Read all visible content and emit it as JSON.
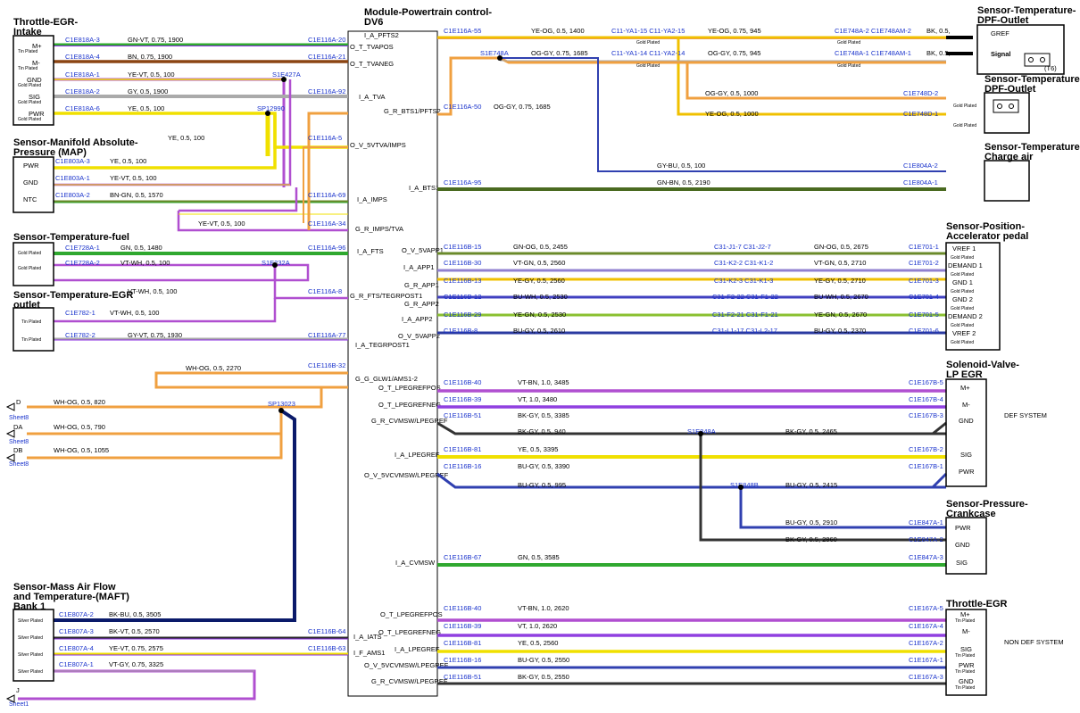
{
  "module": {
    "title_line1": "Module-Powertrain control-",
    "title_line2": "DV6",
    "signals": [
      "I_A_PFTS2",
      "O_T_TVAPOS",
      "O_T_TVANEG",
      "I_A_TVA",
      "G_R_BTS1/PFTS2",
      "O_V_5VTVA/IMPS",
      "I_A_BTS1",
      "I_A_IMPS",
      "G_R_IMPS/TVA",
      "I_A_FTS",
      "O_V_5VAPP1",
      "I_A_APP1",
      "G_R_APP1",
      "G_R_FTS/TEGRPOST1",
      "G_R_APP2",
      "I_A_APP2",
      "O_V_5VAPP2",
      "I_A_TEGRPOST1",
      "G_G_GLW1/AMS1-2",
      "O_T_LPEGREFPOS",
      "O_T_LPEGREFNEG",
      "G_R_CVMSW/LPEGREF",
      "I_A_LPEGREF",
      "O_V_5VCVMSW/LPEGREF",
      "I_A_CVMSW",
      "O_T_LPEGREFPOS",
      "O_T_LPEGREFNEG",
      "I_A_LPEGREF",
      "O_V_5VCVMSW/LPEGREF",
      "G_R_CVMSW/LPEGREF",
      "I_A_IATS",
      "I_F_AMS1"
    ]
  },
  "components": {
    "throttle_intake": {
      "title1": "Throttle-EGR-",
      "title2": "Intake",
      "pins": [
        "M+",
        "M-",
        "GND",
        "SIG",
        "PWR"
      ],
      "plating": [
        "Tin Plated",
        "Tin Plated",
        "Gold Plated",
        "Gold Plated",
        "Gold Plated"
      ]
    },
    "map": {
      "title1": "Sensor-Manifold Absolute-",
      "title2": "Pressure (MAP)",
      "pins": [
        "PWR",
        "GND",
        "NTC"
      ]
    },
    "fuel_temp": {
      "title": "Sensor-Temperature-fuel",
      "plating": [
        "Gold Plated",
        "Gold Plated"
      ]
    },
    "egr_outlet": {
      "title1": "Sensor-Temperature-EGR",
      "title2": "outlet",
      "plating": [
        "Tin Plated",
        "Tin Plated"
      ]
    },
    "maft": {
      "title1": "Sensor-Mass Air Flow",
      "title2": "and Temperature-(MAFT)",
      "title3": "Bank 1",
      "plating": [
        "Silver Plated",
        "Silver Plated",
        "Silver Plated",
        "Silver Plated"
      ]
    },
    "dpf_outlet_1": {
      "title1": "Sensor-Temperature-",
      "title2": "DPF-Outlet",
      "pins": [
        "GREF",
        "Signal"
      ],
      "note": "(T6)"
    },
    "dpf_outlet_2": {
      "title1": "Sensor-Temperature-",
      "title2": "DPF-Outlet",
      "plating": [
        "Gold Plated",
        "Gold Plated"
      ]
    },
    "charge_air": {
      "title1": "Sensor-Temperature-",
      "title2": "Charge air"
    },
    "accel_pedal": {
      "title1": "Sensor-Position-",
      "title2": "Accelerator pedal",
      "pins": [
        "VREF 1",
        "DEMAND 1",
        "GND 1",
        "GND 2",
        "DEMAND 2",
        "VREF 2"
      ],
      "plating": "Gold Plated"
    },
    "lp_egr": {
      "title1": "Solenoid-Valve-",
      "title2": "LP EGR",
      "pins": [
        "M+",
        "M-",
        "GND",
        "SIG",
        "PWR"
      ],
      "note": "DEF SYSTEM"
    },
    "crankcase": {
      "title1": "Sensor-Pressure-",
      "title2": "Crankcase",
      "pins": [
        "PWR",
        "GND",
        "SIG"
      ]
    },
    "throttle_egr": {
      "title": "Throttle-EGR",
      "pins": [
        "M+",
        "M-",
        "SIG",
        "PWR",
        "GND"
      ],
      "plating": "Tin Plated",
      "note": "NON DEF SYSTEM"
    }
  },
  "sheets": [
    {
      "letter": "D",
      "label": "Sheet8"
    },
    {
      "letter": "DA",
      "label": "Sheet8"
    },
    {
      "letter": "DB",
      "label": "Sheet8"
    },
    {
      "letter": "J",
      "label": "Sheet1"
    }
  ],
  "splices": [
    "S1E427A",
    "SP12990",
    "S1E232A",
    "SP13023",
    "S1E748A",
    "S1E848A",
    "S1E848B"
  ],
  "gold_plated": "Gold Plated",
  "left_wires": [
    {
      "c1": "C1E818A-3",
      "desc": "GN-VT, 0.75, 1900",
      "c2": "C1E116A-20"
    },
    {
      "c1": "C1E818A-4",
      "desc": "BN, 0.75, 1900",
      "c2": "C1E116A-21"
    },
    {
      "c1": "C1E818A-1",
      "desc": "YE-VT, 0.5, 100",
      "c2": ""
    },
    {
      "c1": "C1E818A-2",
      "desc": "GY, 0.5, 1900",
      "c2": "C1E116A-92"
    },
    {
      "c1": "C1E818A-6",
      "desc": "YE, 0.5, 100",
      "c2": ""
    },
    {
      "c1": "",
      "desc": "YE, 0.5, 100",
      "c2": "C1E116A-5"
    },
    {
      "c1": "C1E803A-3",
      "desc": "YE, 0.5, 100",
      "c2": ""
    },
    {
      "c1": "C1E803A-1",
      "desc": "YE-VT, 0.5, 100",
      "c2": ""
    },
    {
      "c1": "C1E803A-2",
      "desc": "BN-GN, 0.5, 1570",
      "c2": "C1E116A-69"
    },
    {
      "c1": "",
      "desc": "YE-VT, 0.5, 100",
      "c2": "C1E116A-34"
    },
    {
      "c1": "C1E728A-1",
      "desc": "GN, 0.5, 1480",
      "c2": "C1E116A-96"
    },
    {
      "c1": "C1E728A-2",
      "desc": "VT-WH, 0.5, 100",
      "c2": ""
    },
    {
      "c1": "",
      "desc": "VT-WH, 0.5, 100",
      "c2": "C1E116A-8"
    },
    {
      "c1": "C1E782-1",
      "desc": "VT-WH, 0.5, 100",
      "c2": ""
    },
    {
      "c1": "C1E782-2",
      "desc": "GY-VT, 0.75, 1930",
      "c2": "C1E116A-77"
    },
    {
      "c1": "",
      "desc": "WH-OG, 0.5, 2270",
      "c2": "C1E116B-32"
    },
    {
      "c1": "",
      "desc": "WH-OG, 0.5, 820",
      "c2": ""
    },
    {
      "c1": "",
      "desc": "WH-OG, 0.5, 790",
      "c2": ""
    },
    {
      "c1": "",
      "desc": "WH-OG, 0.5, 1055",
      "c2": ""
    },
    {
      "c1": "C1E807A-2",
      "desc": "BK-BU, 0.5, 3505",
      "c2": ""
    },
    {
      "c1": "C1E807A-3",
      "desc": "BK-VT, 0.5, 2570",
      "c2": "C1E116B-64"
    },
    {
      "c1": "C1E807A-4",
      "desc": "YE-VT, 0.75, 2575",
      "c2": "C1E116B-63"
    },
    {
      "c1": "C1E807A-1",
      "desc": "VT-GY, 0.75, 3325",
      "c2": ""
    }
  ],
  "right_top": [
    {
      "c1": "C1E116A-55",
      "d1": "YE-OG, 0.5, 1400",
      "inline": "C11-YA1-15  C11-YA2-15",
      "d2": "YE-OG, 0.75, 945",
      "c2": "C1E748A-2  C1E748AM-2",
      "d3": "BK, 0.5,"
    },
    {
      "c1": "",
      "d1": "OG-GY, 0.75, 1685",
      "inline": "C11-YA1-14  C11-YA2-14",
      "d2": "OG-GY, 0.75, 945",
      "c2": "C1E748A-1  C1E748AM-1",
      "d3": "BK, 0.5,"
    },
    {
      "c1": "",
      "d1": "",
      "inline": "",
      "d2": "OG-GY, 0.5, 1000",
      "c2": "C1E748D-2",
      "d3": ""
    },
    {
      "c1": "C1E116A-50",
      "d1": "OG-GY, 0.75, 1685",
      "inline": "",
      "d2": "YE-OG, 0.5, 1000",
      "c2": "C1E748D-1",
      "d3": ""
    },
    {
      "c1": "",
      "d1": "",
      "inline": "",
      "d2": "GY-BU, 0.5, 100",
      "c2": "C1E804A-2",
      "d3": ""
    },
    {
      "c1": "C1E116A-95",
      "d1": "",
      "inline": "",
      "d2": "GN-BN, 0.5, 2190",
      "c2": "C1E804A-1",
      "d3": ""
    }
  ],
  "right_app": [
    {
      "c1": "C1E116B-15",
      "d1": "GN-OG, 0.5, 2455",
      "inline": "C31-J1-7  C31-J2-7",
      "d2": "GN-OG, 0.5, 2675",
      "c2": "C1E701-1"
    },
    {
      "c1": "C1E116B-30",
      "d1": "VT-GN, 0.5, 2560",
      "inline": "C31-K2-2  C31-K1-2",
      "d2": "VT-GN, 0.5, 2710",
      "c2": "C1E701-2"
    },
    {
      "c1": "C1E116B-13",
      "d1": "YE-GY, 0.5, 2560",
      "inline": "C31-K2-3  C31-K1-3",
      "d2": "YE-GY, 0.5, 2710",
      "c2": "C1E701-3"
    },
    {
      "c1": "C1E116B-12",
      "d1": "BU-WH, 0.5, 2530",
      "inline": "C31-F2-22  C31-F1-22",
      "d2": "BU-WH, 0.5, 2670",
      "c2": "C1E701-4"
    },
    {
      "c1": "C1E116B-29",
      "d1": "YE-GN, 0.5, 2530",
      "inline": "C31-F2-21  C31-F1-21",
      "d2": "YE-GN, 0.5, 2670",
      "c2": "C1E701-5"
    },
    {
      "c1": "C1E116B-8",
      "d1": "BU-GY, 0.5, 2610",
      "inline": "C31-L1-17  C31-L2-17",
      "d2": "BU-GY, 0.5, 2370",
      "c2": "C1E701-6"
    }
  ],
  "right_egr": [
    {
      "c1": "C1E116B-40",
      "d1": "VT-BN, 1.0, 3485",
      "c2": "C1E167B-5"
    },
    {
      "c1": "C1E116B-39",
      "d1": "VT, 1.0, 3480",
      "c2": "C1E167B-4"
    },
    {
      "c1": "C1E116B-51",
      "d1": "BK-GY, 0.5, 3385",
      "c2": "C1E167B-3"
    },
    {
      "c1": "",
      "d1": "BK-GY, 0.5, 940",
      "c2": ""
    },
    {
      "c1": "",
      "d1": "BK-GY, 0.5, 2465",
      "c2": ""
    },
    {
      "c1": "C1E116B-81",
      "d1": "YE, 0.5, 3395",
      "c2": "C1E167B-2"
    },
    {
      "c1": "C1E116B-16",
      "d1": "BU-GY, 0.5, 3390",
      "c2": "C1E167B-1"
    },
    {
      "c1": "",
      "d1": "BU-GY, 0.5, 995",
      "c2": ""
    },
    {
      "c1": "",
      "d1": "BU-GY, 0.5, 2415",
      "c2": ""
    },
    {
      "c1": "",
      "d1": "BU-GY, 0.5, 2910",
      "c2": "C1E847A-1"
    },
    {
      "c1": "",
      "d1": "BK-GY, 0.5, 2860",
      "c2": "C1E847A-2"
    },
    {
      "c1": "C1E116B-67",
      "d1": "GN, 0.5, 3585",
      "c2": "C1E847A-3"
    }
  ],
  "right_bottom": [
    {
      "c1": "C1E116B-40",
      "d1": "VT-BN, 1.0, 2620",
      "c2": "C1E167A-5"
    },
    {
      "c1": "C1E116B-39",
      "d1": "VT, 1.0, 2620",
      "c2": "C1E167A-4"
    },
    {
      "c1": "C1E116B-81",
      "d1": "YE, 0.5, 2560",
      "c2": "C1E167A-2"
    },
    {
      "c1": "C1E116B-16",
      "d1": "BU-GY, 0.5, 2550",
      "c2": "C1E167A-1"
    },
    {
      "c1": "C1E116B-51",
      "d1": "BK-GY, 0.5, 2550",
      "c2": "C1E167A-3"
    }
  ]
}
